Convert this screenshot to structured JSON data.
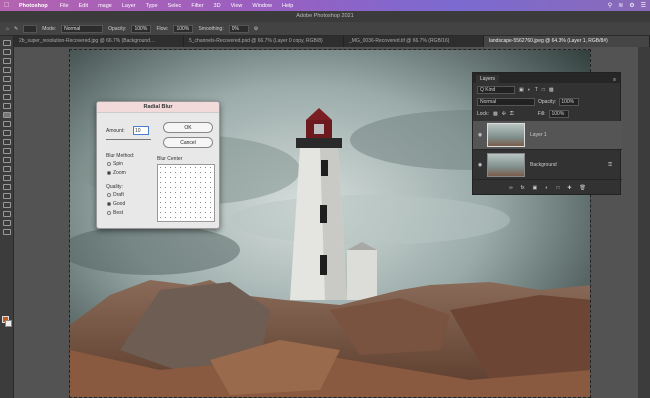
{
  "menubar": {
    "app_name": "Photoshop",
    "items": [
      "File",
      "Edit",
      "mage",
      "Layer",
      "Type",
      "Selec",
      "Filter",
      "3D",
      "View",
      "Window",
      "Help"
    ]
  },
  "titlebar": {
    "text": "Adobe Photoshop 2021"
  },
  "options": {
    "mode_label": "Mode:",
    "mode_value": "Normal",
    "opacity_label": "Opacity:",
    "opacity_value": "100%",
    "flow_label": "Flow:",
    "flow_value": "100%",
    "smoothing_label": "Smoothing:",
    "smoothing_value": "0%"
  },
  "tabs": [
    {
      "label": "2b_super_resolution-Recovered.jpg @ 66.7% (Background…"
    },
    {
      "label": "5_channels-Recovered.psd @ 66.7% (Layer 0 copy, RGB/8)"
    },
    {
      "label": "_MG_0036-Recovered.tif @ 66.7% (RGB/16)"
    },
    {
      "label": "landscape-5562760.jpeg @ 64.3% (Layer 1, RGB/8#)"
    }
  ],
  "dialog": {
    "title": "Radial Blur",
    "amount_label": "Amount:",
    "amount_value": "10",
    "ok_label": "OK",
    "cancel_label": "Cancel",
    "blur_method_label": "Blur Method:",
    "spin_label": "Spin",
    "zoom_label": "Zoom",
    "quality_label": "Quality:",
    "draft_label": "Draft",
    "good_label": "Good",
    "best_label": "Best",
    "blur_center_label": "Blur Center"
  },
  "layers_panel": {
    "tab_label": "Layers",
    "kind_value": "Q Kind",
    "blend_value": "Normal",
    "opacity_label": "Opacity:",
    "opacity_value": "100%",
    "lock_label": "Lock:",
    "fill_label": "Fill:",
    "fill_value": "100%",
    "layers": [
      {
        "name": "Layer 1",
        "selected": true
      },
      {
        "name": "Background",
        "selected": false
      }
    ]
  }
}
